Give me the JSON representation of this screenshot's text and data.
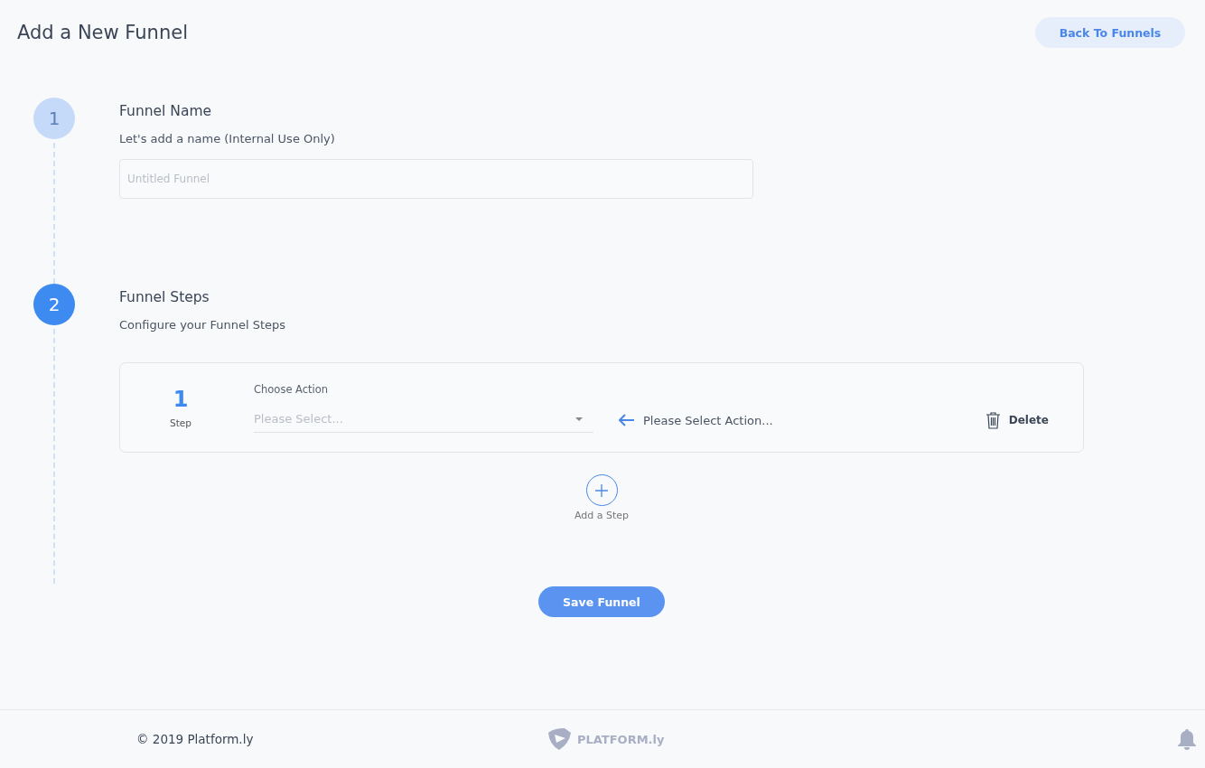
{
  "page": {
    "title": "Add a New Funnel",
    "back_button": "Back To Funnels"
  },
  "sections": [
    {
      "number": "1",
      "active": false,
      "kind": "name",
      "title": "Funnel Name",
      "subtitle": "Let's add a name (Internal Use Only)",
      "field": {
        "placeholder": "Untitled Funnel"
      }
    },
    {
      "number": "2",
      "active": true,
      "kind": "steps",
      "title": "Funnel Steps",
      "subtitle": "Configure your Funnel Steps",
      "steps": [
        {
          "number": "1",
          "label": "Step",
          "action_label": "Choose Action",
          "select": {
            "placeholder": "Please Select..."
          },
          "hint": "Please Select Action...",
          "delete": "Delete"
        }
      ],
      "add_step": "Add a Step"
    }
  ],
  "save_button": "Save Funnel",
  "footer": {
    "copyright": "© 2019 Platform.ly",
    "logo_text": "PLATFORM.ly"
  }
}
